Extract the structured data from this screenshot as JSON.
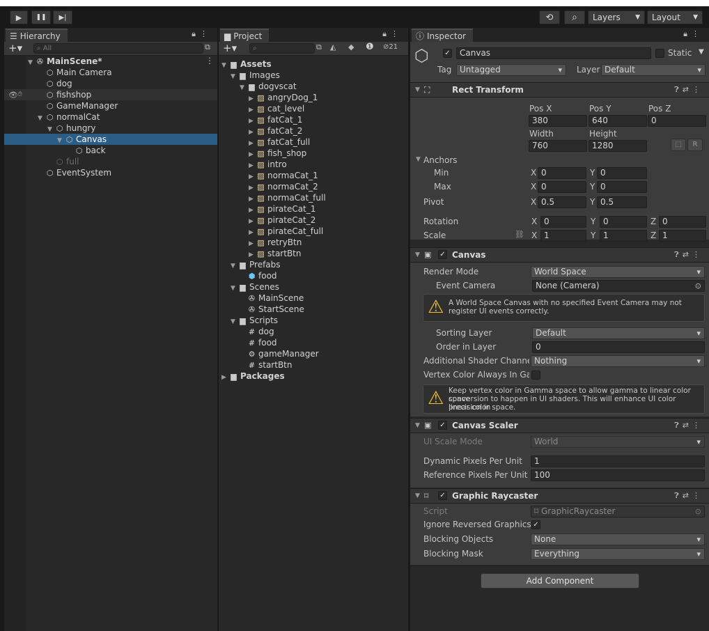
{
  "toolbar": {
    "play": "▶",
    "pause": "❚❚",
    "step": "▶|",
    "history": "⟲",
    "search": "⌕",
    "layers_label": "Layers",
    "layout_label": "Layout"
  },
  "hierarchy": {
    "tab": "Hierarchy",
    "search_placeholder": "All",
    "items": [
      {
        "label": "MainScene*",
        "depth": 0,
        "arrow": "▼",
        "icon": "unity-icon",
        "bold": true
      },
      {
        "label": "Main Camera",
        "depth": 1,
        "arrow": "",
        "icon": "cube-icon"
      },
      {
        "label": "dog",
        "depth": 1,
        "arrow": "",
        "icon": "cube-icon"
      },
      {
        "label": "fishshop",
        "depth": 1,
        "arrow": "",
        "icon": "cube-icon",
        "hilite": true
      },
      {
        "label": "GameManager",
        "depth": 1,
        "arrow": "",
        "icon": "cube-icon"
      },
      {
        "label": "normalCat",
        "depth": 1,
        "arrow": "▼",
        "icon": "cube-icon"
      },
      {
        "label": "hungry",
        "depth": 2,
        "arrow": "▼",
        "icon": "cube-icon"
      },
      {
        "label": "Canvas",
        "depth": 3,
        "arrow": "▼",
        "icon": "cube-icon",
        "selected": true
      },
      {
        "label": "back",
        "depth": 4,
        "arrow": "",
        "icon": "cube-icon"
      },
      {
        "label": "full",
        "depth": 2,
        "arrow": "",
        "icon": "cube-icon",
        "disabled": true
      },
      {
        "label": "EventSystem",
        "depth": 1,
        "arrow": "",
        "icon": "cube-icon"
      }
    ]
  },
  "project": {
    "tab": "Project",
    "hidden_count": "21",
    "items": [
      {
        "label": "Assets",
        "depth": 0,
        "arrow": "▼",
        "icon": "folder-icon",
        "bold": true
      },
      {
        "label": "Images",
        "depth": 1,
        "arrow": "▼",
        "icon": "folder-icon"
      },
      {
        "label": "dogvscat",
        "depth": 2,
        "arrow": "▼",
        "icon": "folder-icon"
      },
      {
        "label": "angryDog_1",
        "depth": 3,
        "arrow": "▶",
        "icon": "sprite-icon"
      },
      {
        "label": "cat_level",
        "depth": 3,
        "arrow": "▶",
        "icon": "sprite-icon"
      },
      {
        "label": "fatCat_1",
        "depth": 3,
        "arrow": "▶",
        "icon": "sprite-icon"
      },
      {
        "label": "fatCat_2",
        "depth": 3,
        "arrow": "▶",
        "icon": "sprite-icon"
      },
      {
        "label": "fatCat_full",
        "depth": 3,
        "arrow": "▶",
        "icon": "sprite-icon"
      },
      {
        "label": "fish_shop",
        "depth": 3,
        "arrow": "▶",
        "icon": "sprite-icon"
      },
      {
        "label": "intro",
        "depth": 3,
        "arrow": "▶",
        "icon": "sprite-icon"
      },
      {
        "label": "normaCat_1",
        "depth": 3,
        "arrow": "▶",
        "icon": "sprite-icon"
      },
      {
        "label": "normaCat_2",
        "depth": 3,
        "arrow": "▶",
        "icon": "sprite-icon"
      },
      {
        "label": "normaCat_full",
        "depth": 3,
        "arrow": "▶",
        "icon": "sprite-icon"
      },
      {
        "label": "pirateCat_1",
        "depth": 3,
        "arrow": "▶",
        "icon": "sprite-icon"
      },
      {
        "label": "pirateCat_2",
        "depth": 3,
        "arrow": "▶",
        "icon": "sprite-icon"
      },
      {
        "label": "pirateCat_full",
        "depth": 3,
        "arrow": "▶",
        "icon": "sprite-icon"
      },
      {
        "label": "retryBtn",
        "depth": 3,
        "arrow": "▶",
        "icon": "sprite-icon"
      },
      {
        "label": "startBtn",
        "depth": 3,
        "arrow": "▶",
        "icon": "sprite-icon"
      },
      {
        "label": "Prefabs",
        "depth": 1,
        "arrow": "▼",
        "icon": "folder-icon"
      },
      {
        "label": "food",
        "depth": 2,
        "arrow": "",
        "icon": "prefab-icon"
      },
      {
        "label": "Scenes",
        "depth": 1,
        "arrow": "▼",
        "icon": "folder-icon"
      },
      {
        "label": "MainScene",
        "depth": 2,
        "arrow": "",
        "icon": "unity-icon"
      },
      {
        "label": "StartScene",
        "depth": 2,
        "arrow": "",
        "icon": "unity-icon"
      },
      {
        "label": "Scripts",
        "depth": 1,
        "arrow": "▼",
        "icon": "folder-icon"
      },
      {
        "label": "dog",
        "depth": 2,
        "arrow": "",
        "icon": "script-icon"
      },
      {
        "label": "food",
        "depth": 2,
        "arrow": "",
        "icon": "script-icon"
      },
      {
        "label": "gameManager",
        "depth": 2,
        "arrow": "",
        "icon": "gear-icon"
      },
      {
        "label": "startBtn",
        "depth": 2,
        "arrow": "",
        "icon": "script-icon"
      },
      {
        "label": "Packages",
        "depth": 0,
        "arrow": "▶",
        "icon": "folder-icon",
        "bold": true
      }
    ]
  },
  "inspector": {
    "tab": "Inspector",
    "object_name": "Canvas",
    "static_label": "Static",
    "tag_label": "Tag",
    "tag_value": "Untagged",
    "layer_label": "Layer",
    "layer_value": "Default",
    "rect": {
      "title": "Rect Transform",
      "posx_label": "Pos X",
      "posy_label": "Pos Y",
      "posz_label": "Pos Z",
      "posx": "380",
      "posy": "640",
      "posz": "0",
      "width_label": "Width",
      "height_label": "Height",
      "width": "760",
      "height": "1280",
      "r_btn": "R",
      "anchors_label": "Anchors",
      "min_label": "Min",
      "max_label": "Max",
      "min_x": "0",
      "min_y": "0",
      "max_x": "0",
      "max_y": "0",
      "pivot_label": "Pivot",
      "pivot_x": "0.5",
      "pivot_y": "0.5",
      "rotation_label": "Rotation",
      "rot_x": "0",
      "rot_y": "0",
      "rot_z": "0",
      "scale_label": "Scale",
      "scale_x": "1",
      "scale_y": "1",
      "scale_z": "1"
    },
    "canvas": {
      "title": "Canvas",
      "render_mode_label": "Render Mode",
      "render_mode": "World Space",
      "event_camera_label": "Event Camera",
      "event_camera": "None (Camera)",
      "warning1_line1": "A World Space Canvas with no specified Event Camera may not",
      "warning1_line2": "register UI events correctly.",
      "sorting_layer_label": "Sorting Layer",
      "sorting_layer": "Default",
      "order_label": "Order in Layer",
      "order": "0",
      "shader_label": "Additional Shader Channels",
      "shader": "Nothing",
      "vertex_label": "Vertex Color Always In Gamma",
      "warning2_line1": "Keep vertex color in Gamma space to allow gamma to linear color space",
      "warning2_line2": "conversion to happen in UI shaders. This will enhance UI color precision in",
      "warning2_line3": "linear color space."
    },
    "scaler": {
      "title": "Canvas Scaler",
      "mode_label": "UI Scale Mode",
      "mode": "World",
      "dyn_label": "Dynamic Pixels Per Unit",
      "dyn": "1",
      "ref_label": "Reference Pixels Per Unit",
      "ref": "100"
    },
    "raycaster": {
      "title": "Graphic Raycaster",
      "script_label": "Script",
      "script": "GraphicRaycaster",
      "ignore_label": "Ignore Reversed Graphics",
      "blocking_label": "Blocking Objects",
      "blocking": "None",
      "mask_label": "Blocking Mask",
      "mask": "Everything"
    },
    "add_component": "Add Component"
  }
}
